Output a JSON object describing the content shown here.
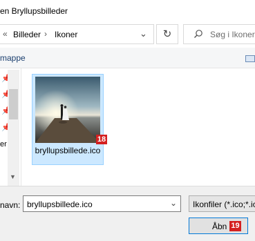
{
  "window": {
    "title": "en Bryllupsbilleder"
  },
  "address": {
    "overflow_chevron": "«",
    "crumbs": [
      "Billeder",
      "Ikoner"
    ],
    "separator": "›",
    "dropdown_glyph": "⌄",
    "refresh_glyph": "↻"
  },
  "search": {
    "placeholder": "Søg i Ikoner"
  },
  "toolbar": {
    "new_folder_label": "mappe"
  },
  "nav": {
    "partial_label": "er"
  },
  "files": [
    {
      "name": "bryllupsbillede.ico",
      "badge": "18",
      "selected": true
    }
  ],
  "bottom": {
    "filename_label": "navn:",
    "filename_value": "bryllupsbillede.ico",
    "filetype_value": "Ikonfiler (*.ico;*.ic",
    "open_label": "Åbn",
    "open_badge": "19"
  },
  "colors": {
    "selection_bg": "#cce8ff",
    "selection_border": "#99d1ff",
    "badge": "#d42020",
    "accent": "#0078d7"
  }
}
